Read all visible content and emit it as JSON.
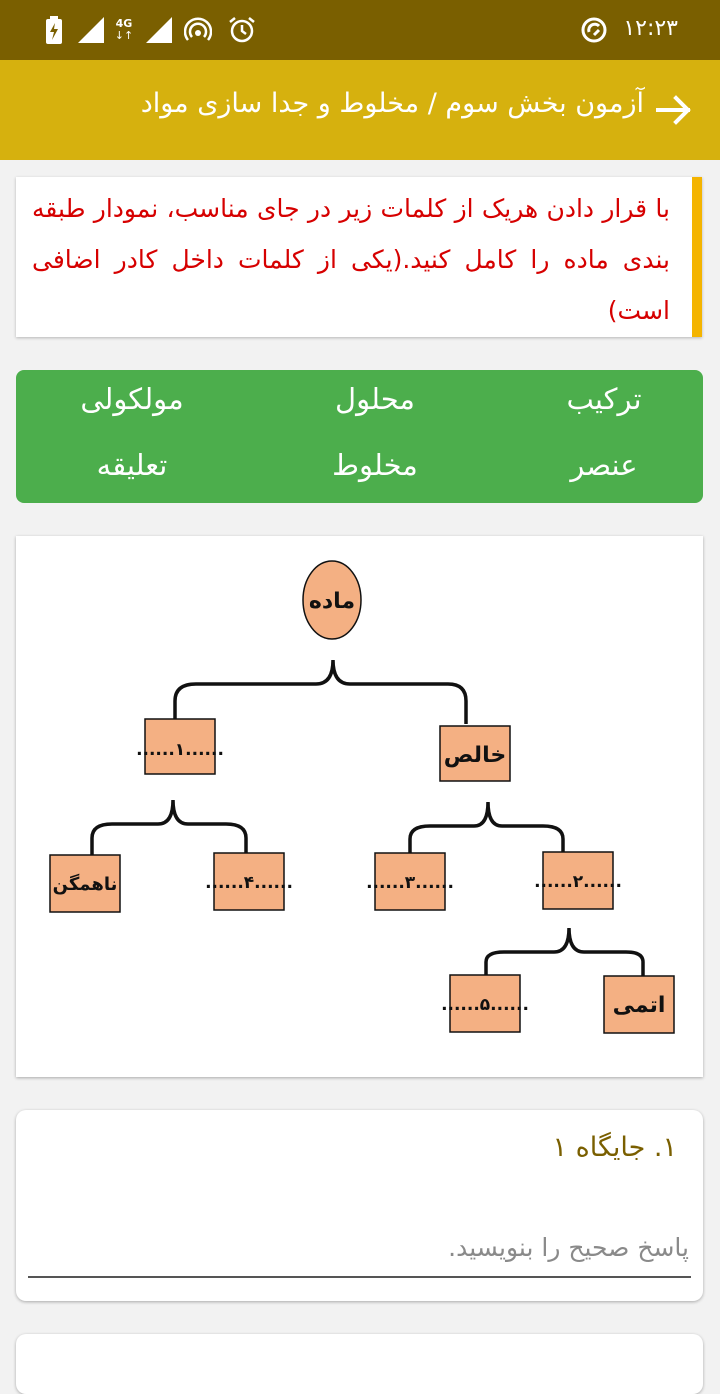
{
  "status_bar": {
    "time": "۱۲:۲۳",
    "network_type": "4G",
    "icons": [
      "battery-charging-icon",
      "signal-icon",
      "signal-4g-icon",
      "signal-icon",
      "hotspot-icon",
      "alarm-icon",
      "sync-icon"
    ]
  },
  "app_bar": {
    "title": "آزمون بخش سوم / مخلوط و جدا سازی مواد",
    "back_icon": "arrow-right-icon"
  },
  "question": {
    "text": "با قرار دادن هریک از کلمات زیر در جای مناسب، نمودار طبقه بندی ماده را کامل کنید.(یکی از کلمات داخل کادر اضافی است)"
  },
  "word_bank": {
    "words": [
      "ترکیب",
      "محلول",
      "مولکولی",
      "عنصر",
      "مخلوط",
      "تعلیقه"
    ]
  },
  "diagram": {
    "root": "ماده",
    "nodes": {
      "n1": "......۱......",
      "pure": "خالص",
      "heterogeneous": "ناهمگن",
      "n4": "......۴......",
      "n3": "......۳......",
      "n2": "......۲......",
      "n5": "......۵......",
      "atomic": "اتمی"
    }
  },
  "answer": {
    "label": "۱. جایگاه ۱",
    "placeholder": "پاسخ صحیح را بنویسید.",
    "value": ""
  },
  "colors": {
    "status_bar": "#7a5f00",
    "app_bar": "#d6b10e",
    "question_text": "#d60000",
    "question_accent": "#f4b400",
    "word_bank": "#4cae4c",
    "node_fill": "#f4b083",
    "answer_label": "#7a5f00"
  }
}
